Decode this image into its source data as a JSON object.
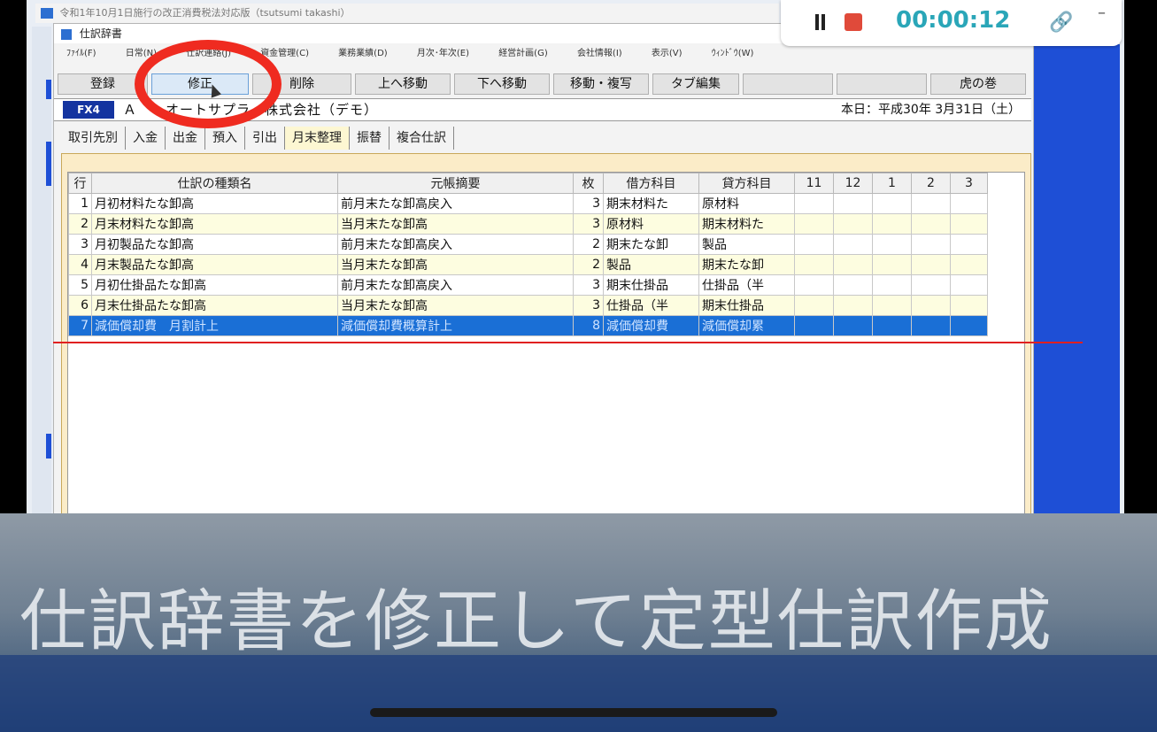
{
  "outer_window": {
    "title": "令和1年10月1日施行の改正消費税法対応版（tsutsumi takashi）"
  },
  "recorder": {
    "time": "00:00:12"
  },
  "dialog": {
    "title": "仕訳辞書",
    "menu": [
      "ﾌｧｲﾙ(F)",
      "日常(N)",
      "仕訳連絡(J)",
      "資金管理(C)",
      "業務業績(D)",
      "月次･年次(E)",
      "経営計画(G)",
      "会社情報(I)",
      "表示(V)",
      "ｳｨﾝﾄﾞｳ(W)"
    ],
    "toolbar": {
      "register": "登録",
      "edit": "修正",
      "delete": "削除",
      "move_up": "上へ移動",
      "move_down": "下へ移動",
      "move_copy": "移動・複写",
      "tab_edit": "タブ編集",
      "tora": "虎の巻"
    },
    "company": {
      "badge": "FX4",
      "name": "Ａ　　オートサプラ　株式会社（デモ）",
      "today": "本日：平成30年 3月31日（土）"
    },
    "tabs": [
      "取引先別",
      "入金",
      "出金",
      "預入",
      "引出",
      "月末整理",
      "振替",
      "複合仕訳"
    ],
    "active_tab": "月末整理",
    "table": {
      "headers": [
        "行",
        "仕訳の種類名",
        "元帳摘要",
        "枚",
        "借方科目",
        "貸方科目",
        "11",
        "12",
        "1",
        "2",
        "3"
      ],
      "rows": [
        [
          "1",
          "月初材料たな卸高",
          "前月末たな卸高戻入",
          "3",
          "期末材料た",
          "原材料"
        ],
        [
          "2",
          "月末材料たな卸高",
          "当月末たな卸高",
          "3",
          "原材料",
          "期末材料た"
        ],
        [
          "3",
          "月初製品たな卸高",
          "前月末たな卸高戻入",
          "2",
          "期末たな卸",
          "製品"
        ],
        [
          "4",
          "月末製品たな卸高",
          "当月末たな卸高",
          "2",
          "製品",
          "期末たな卸"
        ],
        [
          "5",
          "月初仕掛品たな卸高",
          "前月末たな卸高戻入",
          "3",
          "期末仕掛品",
          "仕掛品（半"
        ],
        [
          "6",
          "月末仕掛品たな卸高",
          "当月末たな卸高",
          "3",
          "仕掛品（半",
          "期末仕掛品"
        ],
        [
          "7",
          "減価償却費　月割計上",
          "減価償却費概算計上",
          "8",
          "減価償却費",
          "減価償却累"
        ]
      ],
      "selected_row": 7
    }
  },
  "caption": "仕訳辞書を修正して定型仕訳作成",
  "colors": {
    "accent": "#ef2b20",
    "selection": "#1a6fd6",
    "badge": "#1434a0",
    "timer": "#2aa6b8"
  }
}
